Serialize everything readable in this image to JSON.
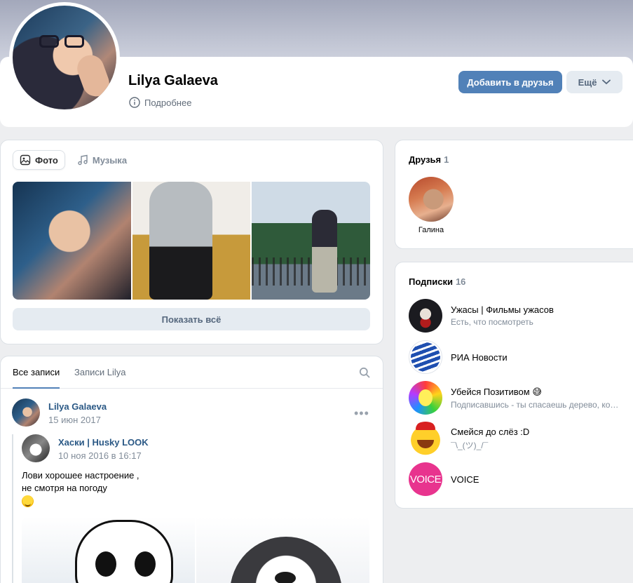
{
  "profile": {
    "name": "Lilya Galaeva",
    "details_label": "Подробнее",
    "add_friend_label": "Добавить в друзья",
    "more_label": "Ещё"
  },
  "media": {
    "tabs": [
      {
        "label": "Фото",
        "icon": "image-icon",
        "active": true
      },
      {
        "label": "Музыка",
        "icon": "music-note-icon",
        "active": false
      }
    ],
    "show_all_label": "Показать всё"
  },
  "wall": {
    "tabs": [
      {
        "label": "Все записи",
        "active": true
      },
      {
        "label": "Записи Lilya",
        "active": false
      }
    ],
    "post": {
      "author": "Lilya Galaeva",
      "date": "15 июн 2017",
      "repost": {
        "author": "Хаски | Husky LOOK",
        "date": "10 ноя 2016 в 16:17",
        "text_line1": "Лови хорошее настроение ,",
        "text_line2": "не смотря на погоду"
      }
    }
  },
  "friends": {
    "title": "Друзья",
    "count": "1",
    "items": [
      {
        "name": "Галина"
      }
    ]
  },
  "subscriptions": {
    "title": "Подписки",
    "count": "16",
    "items": [
      {
        "name": "Ужасы | Фильмы ужасов",
        "desc": "Есть, что посмотреть"
      },
      {
        "name": "РИА Новости",
        "desc": ""
      },
      {
        "name": "Убейся Позитивом 😅",
        "desc": "Подписавшись - ты спасаешь дерево, кошку и маленькую девочку."
      },
      {
        "name": "Смейся до слёз :D",
        "desc": "¯\\_(ツ)_/¯"
      },
      {
        "name": "VOICE",
        "desc": "",
        "logo_text": "VOICE"
      }
    ]
  },
  "colors": {
    "accent": "#5181b8",
    "link": "#2a5885",
    "muted": "#818c99",
    "background": "#edeef0"
  }
}
